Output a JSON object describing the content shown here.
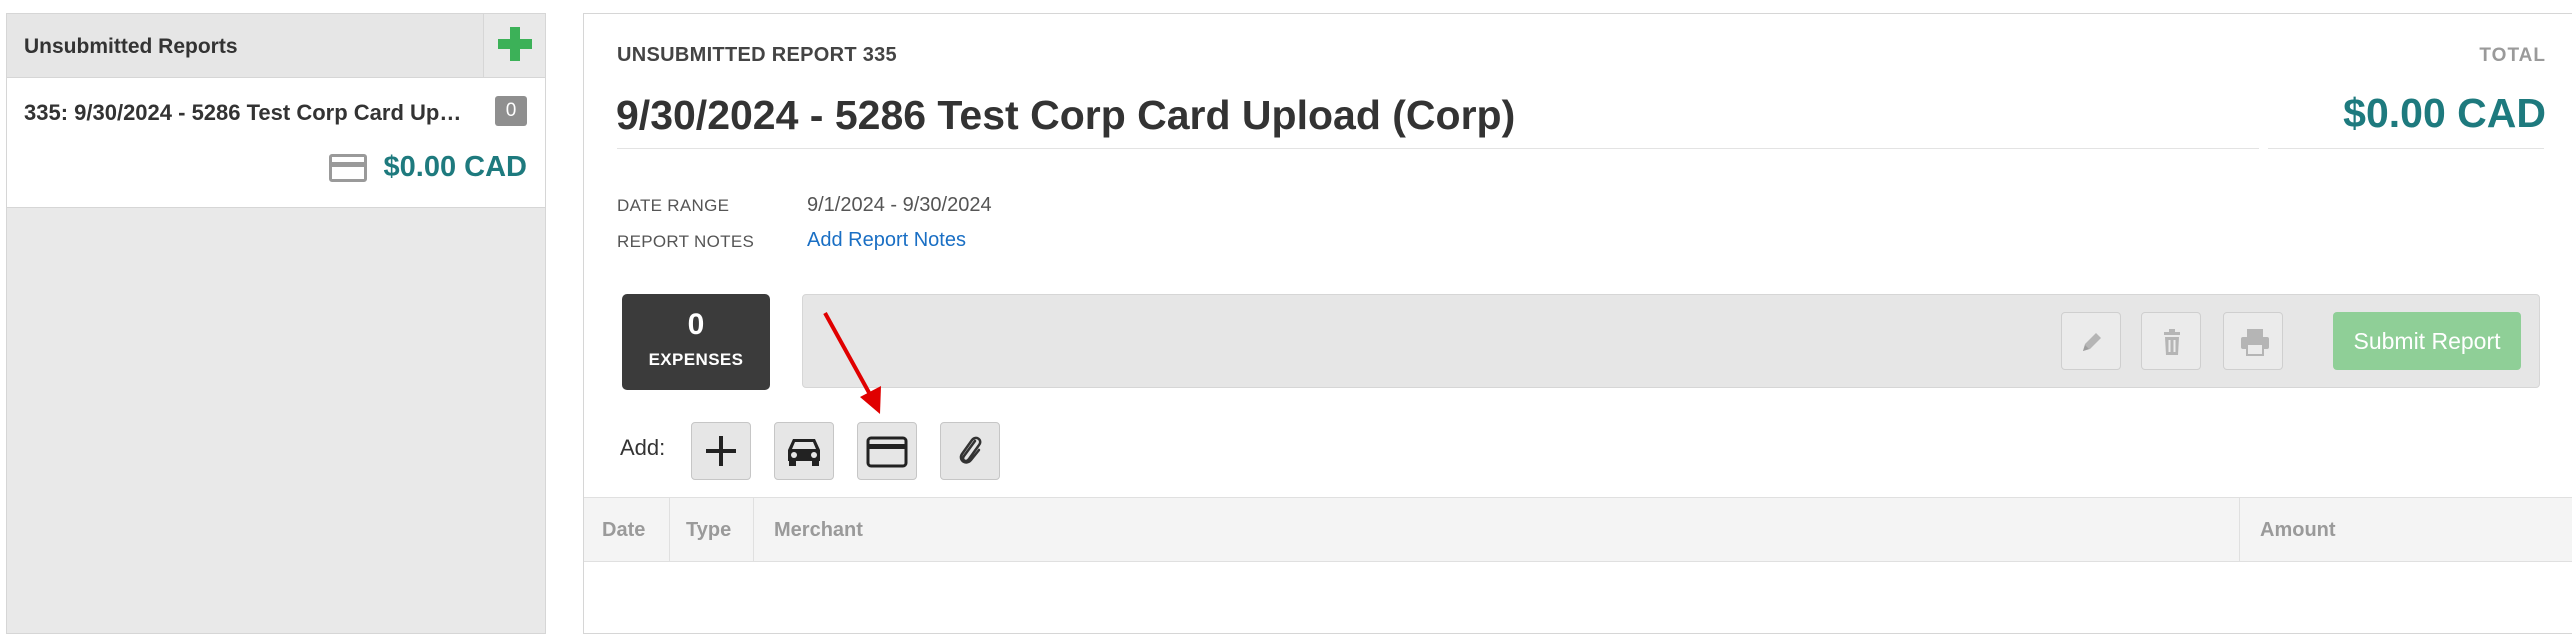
{
  "sidebar": {
    "title": "Unsubmitted Reports",
    "reports": [
      {
        "title": "335: 9/30/2024 - 5286 Test Corp Card Upload (Corp)",
        "count": "0",
        "amount": "$0.00 CAD"
      }
    ]
  },
  "report": {
    "label": "UNSUBMITTED REPORT 335",
    "title": "9/30/2024 - 5286 Test Corp Card Upload (Corp)",
    "total_label": "TOTAL",
    "total_amount": "$0.00 CAD",
    "date_range_label": "DATE RANGE",
    "date_range_value": "9/1/2024 - 9/30/2024",
    "notes_label": "REPORT NOTES",
    "notes_link": "Add Report Notes"
  },
  "expenses": {
    "count": "0",
    "label": "EXPENSES"
  },
  "toolbar": {
    "submit_label": "Submit Report",
    "icons": [
      "pencil-icon",
      "trash-icon",
      "print-icon"
    ]
  },
  "add_bar": {
    "label": "Add:",
    "icons": [
      "plus-icon",
      "car-icon",
      "credit-card-icon",
      "paperclip-icon"
    ]
  },
  "table": {
    "columns": [
      "Date",
      "Type",
      "Merchant",
      "Amount"
    ]
  },
  "colors": {
    "accent_teal": "#1e7a7e",
    "add_green": "#3cb158",
    "submit_green": "#8fcf97",
    "annotation_red": "#e00000"
  }
}
